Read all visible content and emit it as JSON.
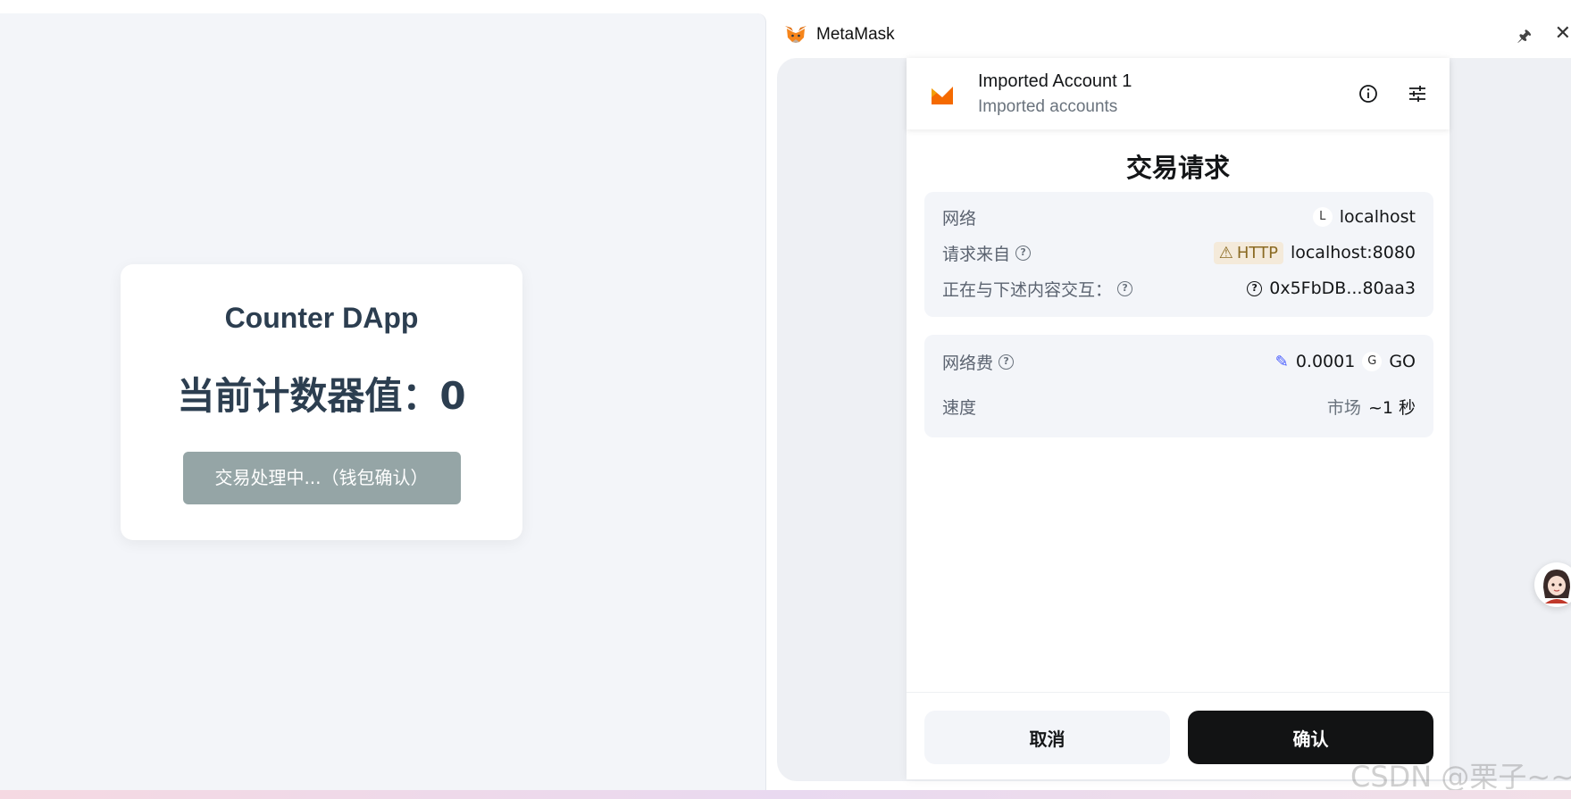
{
  "dapp": {
    "title": "Counter DApp",
    "counter_label": "当前计数器值：0",
    "button_label": "交易处理中...（钱包确认）"
  },
  "window": {
    "app_name": "MetaMask",
    "pin_icon": "pin-icon",
    "close_icon": "close-icon"
  },
  "account": {
    "name": "Imported Account 1",
    "subtitle": "Imported accounts"
  },
  "request": {
    "title": "交易请求",
    "network_label": "网络",
    "network_badge": "L",
    "network_value": "localhost",
    "origin_label": "请求来自",
    "origin_badge": "HTTP",
    "origin_value": "localhost:8080",
    "interact_label": "正在与下述内容交互：",
    "interact_value": "0x5FbDB...80aa3",
    "fee_label": "网络费",
    "fee_value": "0.0001",
    "fee_token_badge": "G",
    "fee_token": "GO",
    "speed_label": "速度",
    "speed_mode": "市场",
    "speed_value": "~1 秒"
  },
  "footer": {
    "cancel_label": "取消",
    "confirm_label": "确认"
  },
  "watermark": "CSDN @栗子~~",
  "colors": {
    "dapp_bg": "#f3f5f9",
    "dapp_button": "#95a5a6",
    "confirm_button": "#121314",
    "metamask_orange": "#e2761b"
  }
}
